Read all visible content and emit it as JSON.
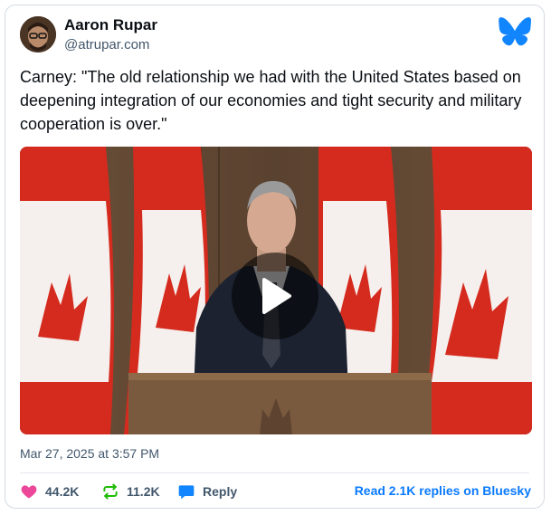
{
  "author": {
    "display_name": "Aaron Rupar",
    "handle": "@atrupar.com",
    "avatar_icon": "avatar"
  },
  "brand": {
    "logo_icon": "bluesky-butterfly-icon",
    "color": "#1185fe"
  },
  "post": {
    "text": "Carney: \"The old relationship we had with the United States based on deepening integration of our economies and tight security and military cooperation is over.\"",
    "timestamp": "Mar 27, 2025 at 3:57 PM"
  },
  "media": {
    "type": "video",
    "play_icon": "play-icon"
  },
  "stats": {
    "likes": "44.2K",
    "reposts": "11.2K",
    "reply_label": "Reply"
  },
  "footer": {
    "read_replies": "Read 2.1K replies on Bluesky"
  },
  "colors": {
    "like": "#ec4899",
    "repost": "#20bc07",
    "reply": "#1185fe",
    "link": "#0a7aff"
  }
}
